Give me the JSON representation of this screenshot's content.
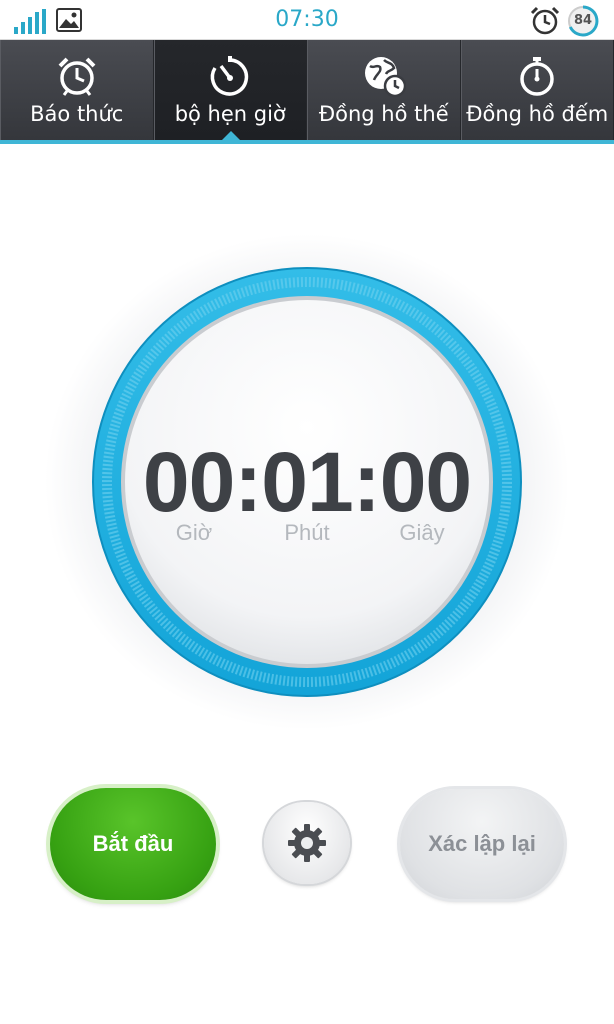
{
  "status_bar": {
    "time": "07:30",
    "battery_level": "84",
    "icons": [
      "signal-icon",
      "gallery-icon",
      "alarm-icon",
      "battery-icon"
    ],
    "accent_color": "#2aa8c8"
  },
  "tabs": [
    {
      "label": "Báo thức",
      "icon": "alarm-clock-icon",
      "active": false
    },
    {
      "label": "bộ hẹn giờ",
      "icon": "timer-icon",
      "active": true
    },
    {
      "label": "Đồng hồ thế",
      "icon": "world-clock-icon",
      "active": false
    },
    {
      "label": "Đồng hồ đếm",
      "icon": "stopwatch-icon",
      "active": false
    }
  ],
  "timer": {
    "display": "00:01:00",
    "units": {
      "hours": "Giờ",
      "minutes": "Phút",
      "seconds": "Giây"
    },
    "ring_color": "#1fb0e0"
  },
  "buttons": {
    "start": "Bắt đầu",
    "settings_icon": "gear-icon",
    "reset": "Xác lập lại",
    "start_color": "#3aa616"
  }
}
